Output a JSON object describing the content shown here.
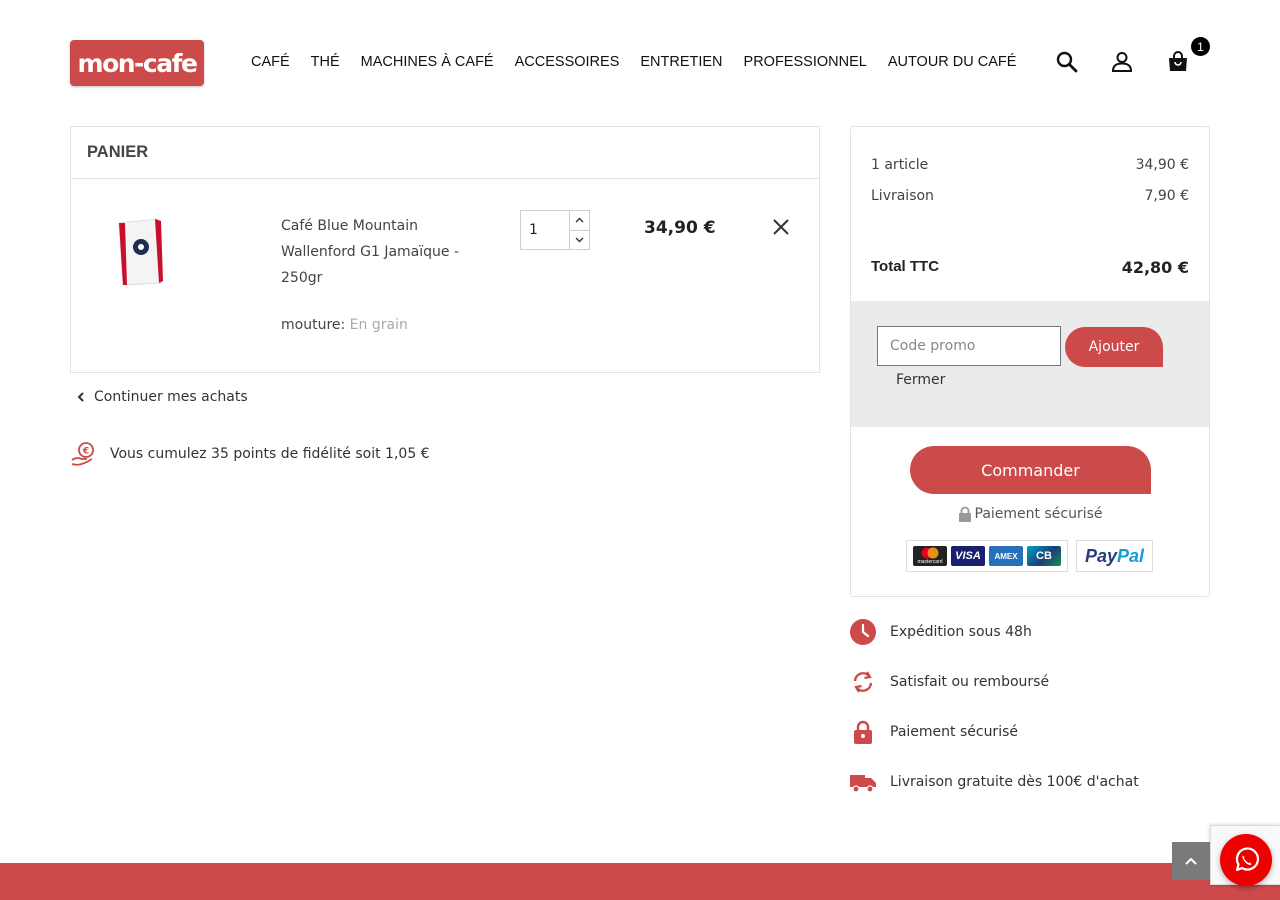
{
  "header": {
    "logo_text": "mon-cafe",
    "nav": [
      "CAFÉ",
      "THÉ",
      "MACHINES À CAFÉ",
      "ACCESSOIRES",
      "ENTRETIEN",
      "PROFESSIONNEL",
      "AUTOUR DU CAFÉ"
    ],
    "cart_count": "1"
  },
  "cart": {
    "title": "PANIER",
    "item": {
      "name": "Café Blue Mountain Wallenford G1 Jamaïque - 250gr",
      "attr_label": "mouture:",
      "attr_value": "En grain",
      "quantity": "1",
      "price": "34,90 €"
    },
    "continue_label": "Continuer mes achats",
    "loyalty_text": "Vous cumulez 35 points de fidélité soit 1,05 €"
  },
  "summary": {
    "items_label": "1 article",
    "items_value": "34,90 €",
    "shipping_label": "Livraison",
    "shipping_value": "7,90 €",
    "total_label": "Total TTC",
    "total_value": "42,80 €",
    "promo_placeholder": "Code promo",
    "promo_button": "Ajouter",
    "promo_close": "Fermer",
    "order_button": "Commander",
    "secure_label": "Paiement sécurisé",
    "payment_logos": [
      "mastercard",
      "VISA",
      "AMEX",
      "CB"
    ],
    "paypal_pay": "Pay",
    "paypal_pal": "Pal"
  },
  "reassurance": [
    {
      "icon": "clock-icon",
      "label": "Expédition sous 48h"
    },
    {
      "icon": "refresh-icon",
      "label": "Satisfait ou remboursé"
    },
    {
      "icon": "padlock-icon",
      "label": "Paiement sécurisé"
    },
    {
      "icon": "truck-icon",
      "label": "Livraison gratuite dès 100€ d'achat"
    }
  ],
  "colors": {
    "brand": "#cc4a4a",
    "promo_bg": "#ebebeb"
  }
}
